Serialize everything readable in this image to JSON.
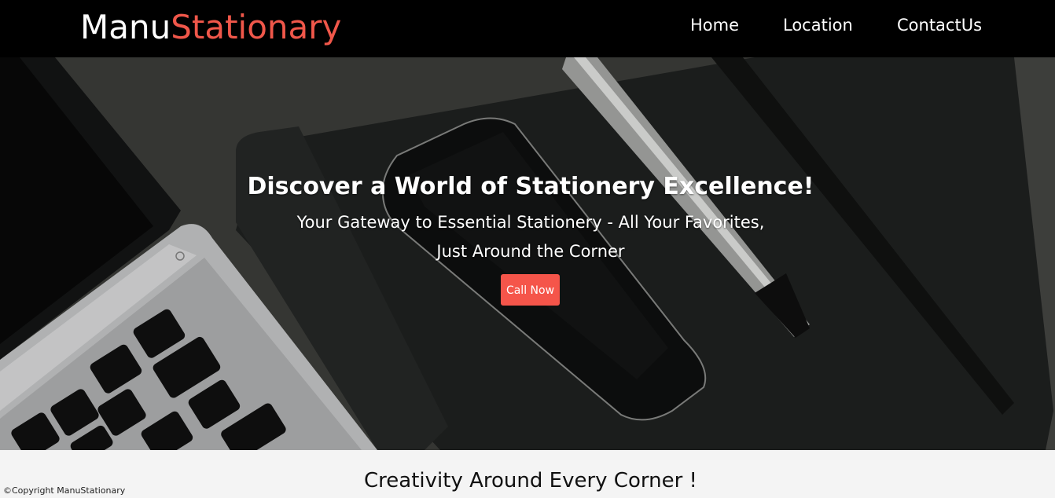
{
  "navbar": {
    "brand_part1": "Manu",
    "brand_part2": "Stationary",
    "links": [
      "Home",
      "Location",
      "ContactUs"
    ]
  },
  "hero": {
    "title": "Discover a World of Stationery Excellence!",
    "subtitle_line1": "Your Gateway to Essential Stationery - All Your Favorites,",
    "subtitle_line2": "Just Around the Corner",
    "cta_label": "Call Now"
  },
  "section": {
    "title": "Creativity Around Every Corner !"
  },
  "footer": {
    "copyright": "©Copyright ManuStationary"
  },
  "colors": {
    "navbar_bg": "#000000",
    "brand_accent": "#f0574a",
    "cta_bg": "#f5554a",
    "page_bg": "#f4f4f4"
  }
}
